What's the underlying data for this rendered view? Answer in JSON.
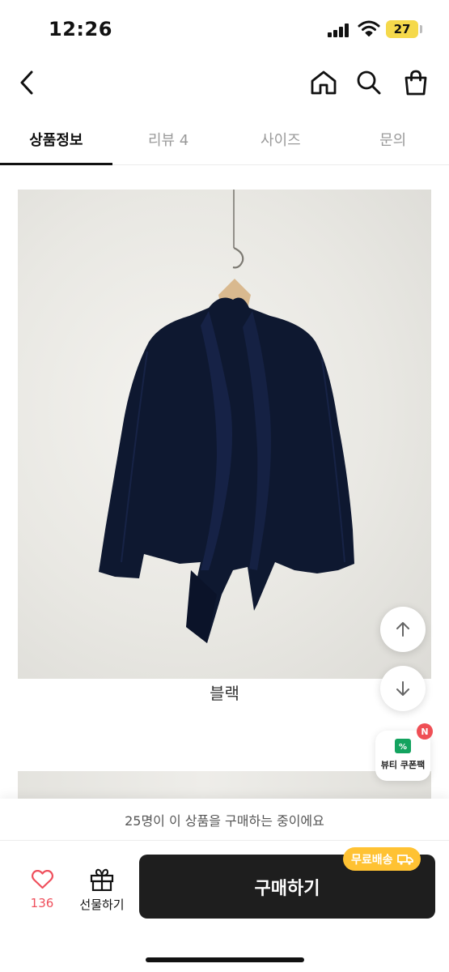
{
  "status_bar": {
    "time": "12:26",
    "battery": "27"
  },
  "header": {
    "back_icon": "chevron-left-icon",
    "home_icon": "home-icon",
    "search_icon": "search-icon",
    "cart_icon": "shopping-bag-icon"
  },
  "tabs": [
    {
      "label": "상품정보",
      "active": true
    },
    {
      "label": "리뷰 4",
      "active": false
    },
    {
      "label": "사이즈",
      "active": false
    },
    {
      "label": "문의",
      "active": false
    }
  ],
  "product": {
    "caption": "블랙"
  },
  "floating": {
    "scroll_up_icon": "arrow-up-icon",
    "scroll_down_icon": "arrow-down-icon",
    "coupon_label": "뷰티 쿠폰팩",
    "coupon_badge": "N"
  },
  "bottom_bar": {
    "buyers_notice": "25명이 이 상품을 구매하는 중이에요",
    "like_count": "136",
    "gift_label": "선물하기",
    "buy_label": "구매하기",
    "shipping_badge": "무료배송"
  },
  "colors": {
    "accent": "#ef4f5c",
    "buy_button": "#1e1e1e",
    "shipping_badge": "#ffc233",
    "battery": "#f5d94b"
  }
}
